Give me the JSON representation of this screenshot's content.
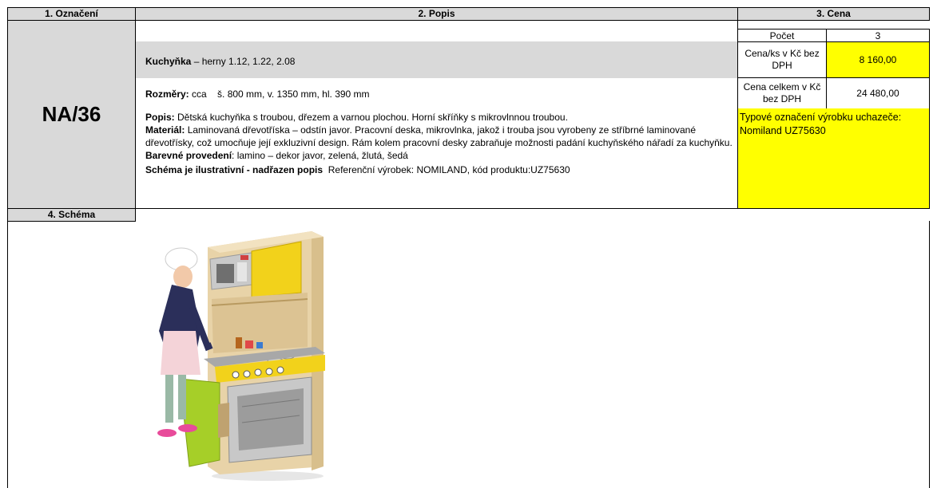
{
  "headers": {
    "col1": "1. Označení",
    "col2": "2. Popis",
    "col3": "3. Cena",
    "schema": "4. Schéma"
  },
  "code": "NA/36",
  "item": {
    "name_label": "Kuchyňka",
    "name_rest": " – herny 1.12, 1.22, 2.08",
    "dimensions_label": "Rozměry:",
    "dimensions_value": " cca    š. 800 mm, v. 1350 mm, hl. 390 mm",
    "popis_label": "Popis:",
    "popis_value": " Dětská kuchyňka s troubou, dřezem a varnou plochou. Horní skříňky s mikrovlnnou troubou.",
    "material_label": "Materiál:",
    "material_value": " Laminovaná dřevotříska – odstín javor. Pracovní deska, mikrovlnka, jakož i trouba jsou vyrobeny ze stříbrné laminované dřevotřísky, což umocňuje její exkluzivní design. Rám kolem pracovní desky zabraňuje možnosti padání kuchyňského nářadí za kuchyňku.",
    "barevne_label": "Barevné provedení",
    "barevne_value": ": lamino – dekor javor, zelená, žlutá, šedá",
    "schema_label": "Schéma je ilustrativní - nadřazen popis",
    "schema_value": "  Referenční výrobek: NOMILAND, kód produktu:UZ75630"
  },
  "price": {
    "count_label": "Počet",
    "count_value": "3",
    "unit_label": "Cena/ks v Kč bez DPH",
    "unit_value": "8 160,00",
    "total_label": "Cena celkem v Kč bez DPH",
    "total_value": "24 480,00",
    "type_label": "Typové označení výrobku uchazeče:",
    "type_value": "Nomiland UZ75630"
  }
}
